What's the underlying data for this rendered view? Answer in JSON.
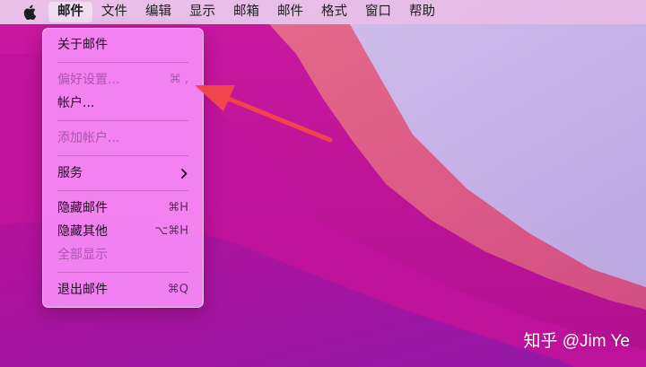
{
  "menubar": {
    "apple_icon": "apple-logo-icon",
    "items": [
      {
        "label": "邮件"
      },
      {
        "label": "文件"
      },
      {
        "label": "编辑"
      },
      {
        "label": "显示"
      },
      {
        "label": "邮箱"
      },
      {
        "label": "邮件"
      },
      {
        "label": "格式"
      },
      {
        "label": "窗口"
      },
      {
        "label": "帮助"
      }
    ]
  },
  "dropdown": {
    "items": [
      {
        "label": "关于邮件",
        "shortcut": "",
        "disabled": false
      },
      {
        "label": "偏好设置...",
        "shortcut": "⌘ ,",
        "disabled": true
      },
      {
        "label": "帐户...",
        "shortcut": "",
        "disabled": false
      },
      {
        "label": "添加帐户...",
        "shortcut": "",
        "disabled": true
      },
      {
        "label": "服务",
        "shortcut": "",
        "disabled": false,
        "submenu_icon": "chevron-right-icon"
      },
      {
        "label": "隐藏邮件",
        "shortcut": "⌘H",
        "disabled": false
      },
      {
        "label": "隐藏其他",
        "shortcut": "⌥⌘H",
        "disabled": false
      },
      {
        "label": "全部显示",
        "shortcut": "",
        "disabled": true
      },
      {
        "label": "退出邮件",
        "shortcut": "⌘Q",
        "disabled": false
      }
    ]
  },
  "annotation": {
    "arrow_color": "#f0454b",
    "arrow_icon": "arrow-pointer-icon"
  },
  "watermark": {
    "text": "知乎 @Jim Ye"
  },
  "colors": {
    "wallpaper_magenta": "#c4169c",
    "wallpaper_lilac": "#c9b4e8",
    "wallpaper_coral": "#e0607a"
  }
}
